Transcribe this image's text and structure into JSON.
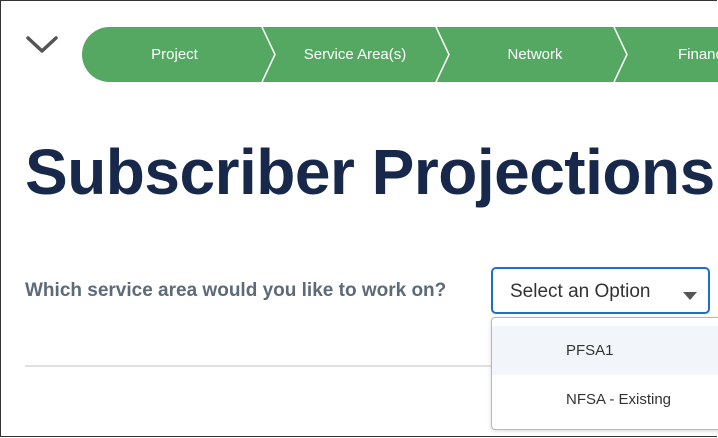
{
  "steps": [
    "Project",
    "Service Area(s)",
    "Network",
    "Financ"
  ],
  "page": {
    "title": "Subscriber Projections"
  },
  "form": {
    "question": "Which service area would you like to work on?",
    "select_placeholder": "Select an Option",
    "options": [
      "PFSA1",
      "NFSA - Existing"
    ],
    "highlighted_option": "PFSA1"
  },
  "colors": {
    "step_bg": "#55a862",
    "title": "#17284a",
    "question": "#5d6a7a",
    "select_border": "#1e6fc9"
  },
  "icons": {
    "collapse": "chevron-down-icon",
    "select_arrow": "caret-down-icon"
  }
}
